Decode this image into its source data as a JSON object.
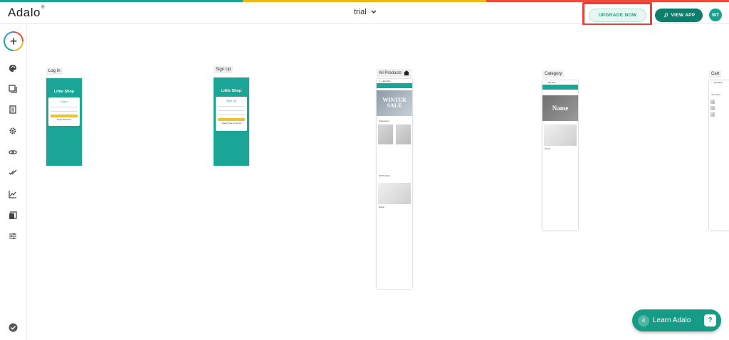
{
  "colors": {
    "stripe": [
      "#1aa596",
      "#f2b51c",
      "#ef4a3a"
    ],
    "brand_teal": "#1aa596",
    "highlight_red": "#e5423a"
  },
  "header": {
    "logo": "Adalo",
    "app_name": "trial",
    "upgrade_label": "UPGRADE NOW",
    "view_app_label": "VIEW APP",
    "avatar_initials": "WT"
  },
  "sidebar": {
    "add_icon": "plus-icon",
    "items": [
      {
        "icon": "palette-icon"
      },
      {
        "icon": "screens-icon"
      },
      {
        "icon": "database-icon"
      },
      {
        "icon": "gear-icon"
      },
      {
        "icon": "link-icon"
      },
      {
        "icon": "double-check-icon"
      },
      {
        "icon": "analytics-icon"
      },
      {
        "icon": "copy-icon"
      },
      {
        "icon": "sliders-icon"
      }
    ],
    "bottom_icon": "check-circle-icon"
  },
  "screens": {
    "login": {
      "label": "Log In",
      "shop": "Little Shop",
      "card_title": "Log In",
      "email": "Email",
      "password": "Password",
      "forgot": "Forgot Password?",
      "signup": "Sign Up"
    },
    "signup": {
      "label": "Sign Up",
      "shop": "Little Shop",
      "card_title": "Sign Up",
      "email": "Email",
      "password": "Password",
      "fullname": "Full Name",
      "have_account": "I already have an account"
    },
    "all_products": {
      "label": "All Products",
      "brand": "Little Shop",
      "banner": "WINTER SALE",
      "categories": "Categories",
      "all_products": "All Products",
      "item": "Name"
    },
    "category": {
      "label": "Category",
      "brand": "Little Shop",
      "hero": "Name",
      "item": "Name"
    },
    "cart": {
      "label": "Cart",
      "brand": "Little Shop",
      "title": "Your Cart"
    }
  },
  "learn": {
    "count": "4",
    "label": "Learn Adalo"
  }
}
